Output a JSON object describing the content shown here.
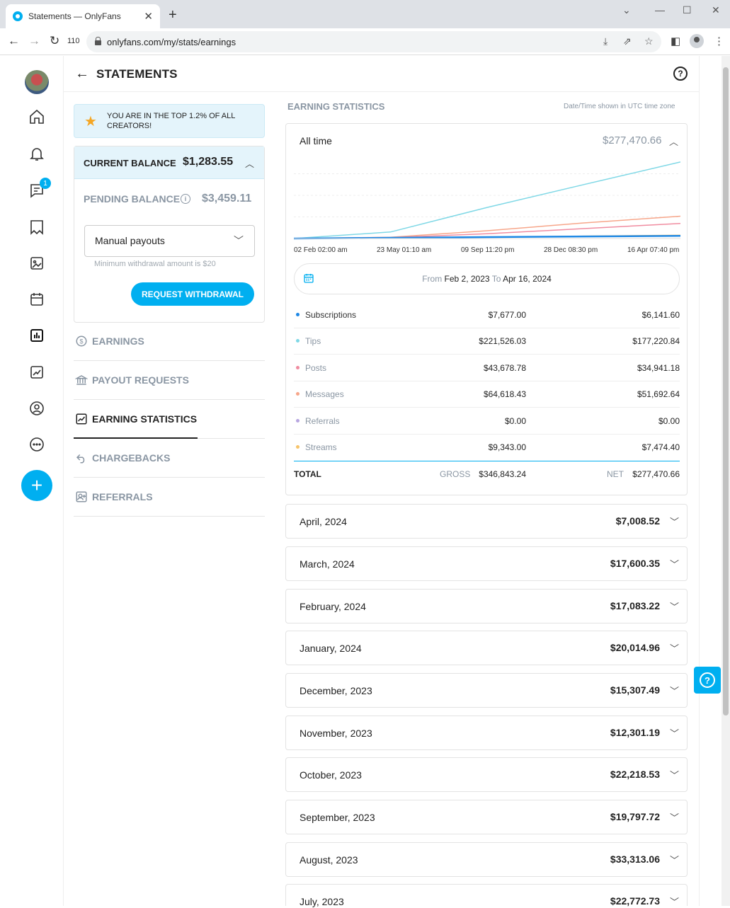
{
  "browser": {
    "tab_title": "Statements — OnlyFans",
    "tab_close": "✕",
    "new_tab": "+",
    "tab_count": "110",
    "url": "onlyfans.com/my/stats/earnings"
  },
  "header": {
    "title": "STATEMENTS",
    "help": "?"
  },
  "rail": {
    "messages_badge": "1",
    "fab": "+"
  },
  "banner": {
    "text": "YOU ARE IN THE TOP 1.2% OF ALL CREATORS!"
  },
  "balance": {
    "current_label": "CURRENT BALANCE",
    "current_value": "$1,283.55",
    "pending_label": "PENDING BALANCE",
    "pending_value": "$3,459.11",
    "payout_method": "Manual payouts",
    "min_note": "Minimum withdrawal amount is $20",
    "withdraw_button": "REQUEST WITHDRAWAL"
  },
  "side_nav": [
    {
      "label": "EARNINGS",
      "active": false
    },
    {
      "label": "PAYOUT REQUESTS",
      "active": false
    },
    {
      "label": "EARNING STATISTICS",
      "active": true
    },
    {
      "label": "CHARGEBACKS",
      "active": false
    },
    {
      "label": "REFERRALS",
      "active": false
    }
  ],
  "stats": {
    "section_title": "EARNING STATISTICS",
    "timezone_note": "Date/Time shown in UTC time zone",
    "period_label": "All time",
    "period_total": "$277,470.66",
    "range_from_label": "From",
    "range_from": "Feb 2, 2023",
    "range_to_label": "To",
    "range_to": "Apr 16, 2024",
    "rows": [
      {
        "name": "Subscriptions",
        "gross": "$7,677.00",
        "net": "$6,141.60",
        "color": "#1e88e5"
      },
      {
        "name": "Tips",
        "gross": "$221,526.03",
        "net": "$177,220.84",
        "color": "#7fd8e6"
      },
      {
        "name": "Posts",
        "gross": "$43,678.78",
        "net": "$34,941.18",
        "color": "#f08ca0"
      },
      {
        "name": "Messages",
        "gross": "$64,618.43",
        "net": "$51,692.64",
        "color": "#f7a68a"
      },
      {
        "name": "Referrals",
        "gross": "$0.00",
        "net": "$0.00",
        "color": "#b7a6e0"
      },
      {
        "name": "Streams",
        "gross": "$9,343.00",
        "net": "$7,474.40",
        "color": "#f7c46a"
      }
    ],
    "total_label": "TOTAL",
    "gross_label": "GROSS",
    "total_gross": "$346,843.24",
    "net_label": "NET",
    "total_net": "$277,470.66"
  },
  "chart_data": {
    "type": "line",
    "x": [
      "02 Feb 02:00 am",
      "23 May 01:10 am",
      "09 Sep 11:20 pm",
      "28 Dec 08:30 pm",
      "16 Apr 07:40 pm"
    ],
    "series": [
      {
        "name": "Tips",
        "values": [
          0,
          15000,
          72000,
          125000,
          177220.84
        ],
        "color": "#7fd8e6"
      },
      {
        "name": "Messages",
        "values": [
          0,
          3000,
          18000,
          36000,
          51692.64
        ],
        "color": "#f7a68a"
      },
      {
        "name": "Posts",
        "values": [
          0,
          2000,
          11000,
          23000,
          34941.18
        ],
        "color": "#f08ca0"
      },
      {
        "name": "Streams",
        "values": [
          0,
          1500,
          3000,
          5500,
          7474.4
        ],
        "color": "#f7c46a"
      },
      {
        "name": "Subscriptions",
        "values": [
          0,
          1600,
          3200,
          4800,
          6141.6
        ],
        "color": "#1e88e5"
      }
    ],
    "ylim": [
      0,
      200000
    ],
    "grid": true
  },
  "months": [
    {
      "label": "April, 2024",
      "amount": "$7,008.52"
    },
    {
      "label": "March, 2024",
      "amount": "$17,600.35"
    },
    {
      "label": "February, 2024",
      "amount": "$17,083.22"
    },
    {
      "label": "January, 2024",
      "amount": "$20,014.96"
    },
    {
      "label": "December, 2023",
      "amount": "$15,307.49"
    },
    {
      "label": "November, 2023",
      "amount": "$12,301.19"
    },
    {
      "label": "October, 2023",
      "amount": "$22,218.53"
    },
    {
      "label": "September, 2023",
      "amount": "$19,797.72"
    },
    {
      "label": "August, 2023",
      "amount": "$33,313.06"
    },
    {
      "label": "July, 2023",
      "amount": "$22,772.73"
    }
  ],
  "colors": {
    "accent": "#00aff0",
    "muted": "#8a96a3"
  }
}
